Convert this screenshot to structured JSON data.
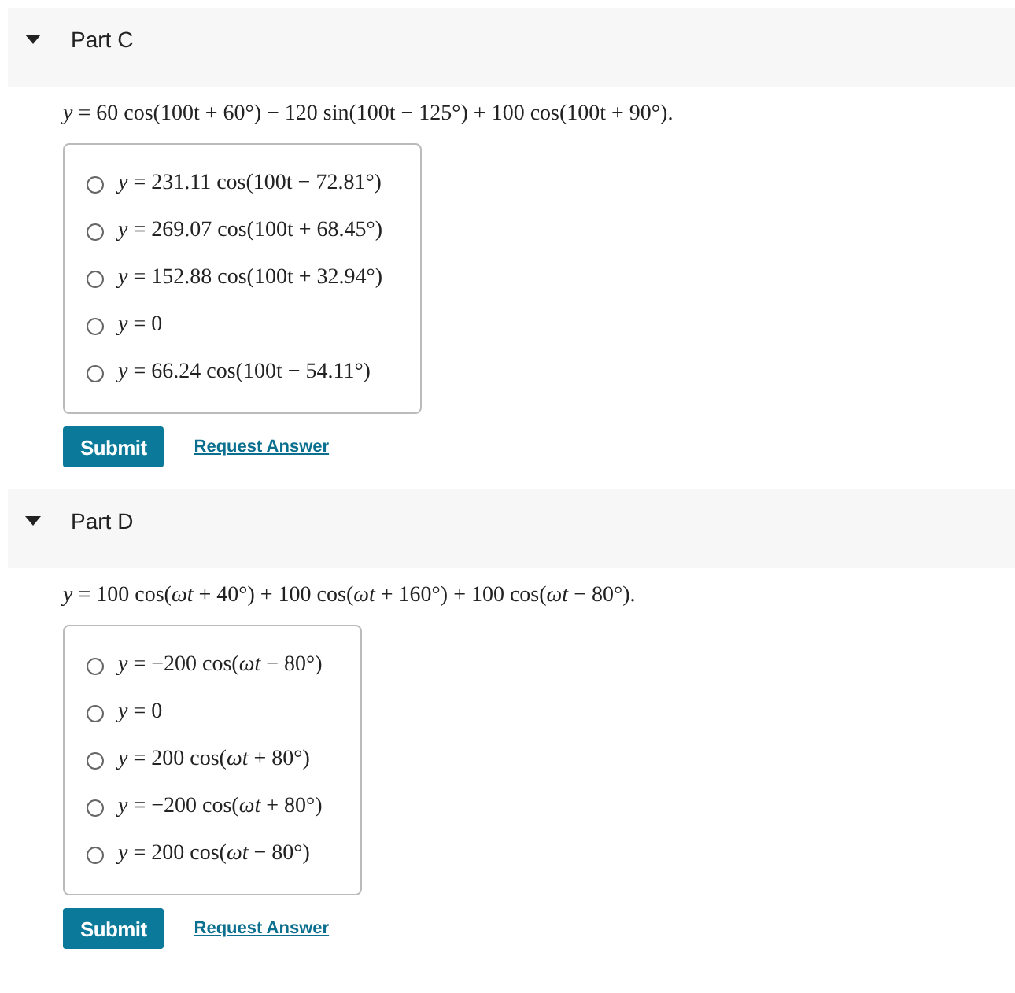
{
  "parts": [
    {
      "title": "Part C",
      "expanded": true,
      "equation": "*y* = 60 cos(100t + 60°) − 120 sin(100t − 125°) + 100 cos(100t + 90°).",
      "options": [
        {
          "text": "*y* = 231.11 cos(100t − 72.81°)",
          "selected": false
        },
        {
          "text": "*y* = 269.07 cos(100t + 68.45°)",
          "selected": false
        },
        {
          "text": "*y* = 152.88 cos(100t + 32.94°)",
          "selected": false
        },
        {
          "text": "*y* = 0",
          "selected": false
        },
        {
          "text": "*y* = 66.24 cos(100t − 54.11°)",
          "selected": false
        }
      ],
      "submit": "Submit",
      "request": "Request Answer"
    },
    {
      "title": "Part D",
      "expanded": true,
      "equation": "*y* = 100 cos(*ωt* + 40°) + 100 cos(*ωt* + 160°) + 100 cos(*ωt* − 80°).",
      "options": [
        {
          "text": "*y* = −200 cos(*ωt* − 80°)",
          "selected": false
        },
        {
          "text": "*y* = 0",
          "selected": false
        },
        {
          "text": "*y* = 200 cos(*ωt* + 80°)",
          "selected": false
        },
        {
          "text": "*y* = −200 cos(*ωt* + 80°)",
          "selected": false
        },
        {
          "text": "*y* = 200 cos(*ωt* − 80°)",
          "selected": false
        }
      ],
      "submit": "Submit",
      "request": "Request Answer"
    }
  ]
}
